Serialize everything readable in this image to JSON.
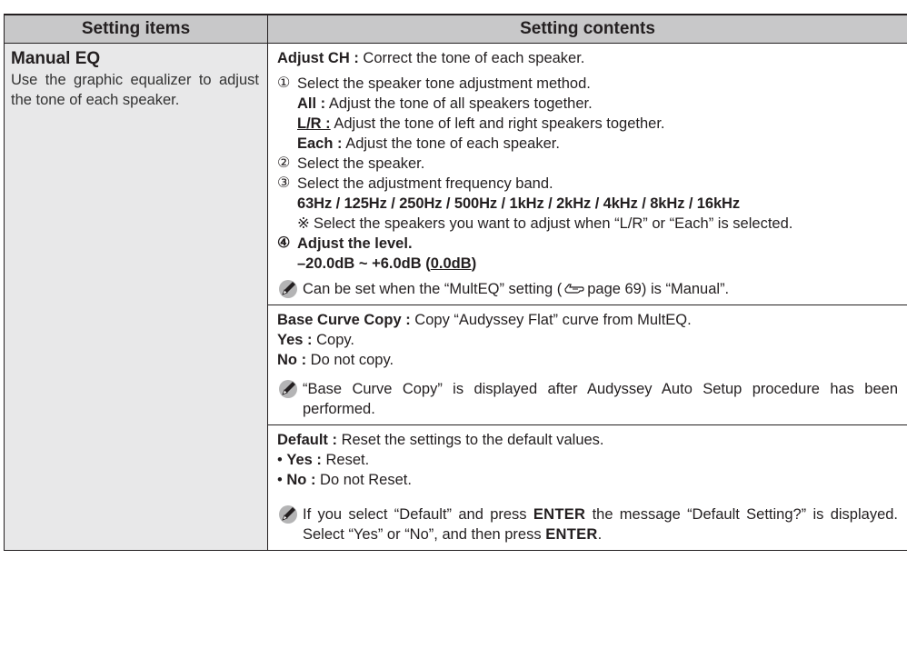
{
  "header": {
    "col_items": "Setting items",
    "col_contents": "Setting contents"
  },
  "item": {
    "title": "Manual EQ",
    "description": "Use the graphic equalizer to adjust the tone of each speaker."
  },
  "adjust_ch": {
    "label": "Adjust CH :",
    "text": " Correct the tone of each speaker.",
    "step1": {
      "num": "①",
      "text": "Select the speaker tone adjustment method.",
      "options": [
        {
          "label": "All :",
          "text": " Adjust the tone of all speakers together."
        },
        {
          "label": "L/R :",
          "text": " Adjust the tone of left and right speakers together."
        },
        {
          "label": "Each :",
          "text": " Adjust the tone of each speaker."
        }
      ]
    },
    "step2": {
      "num": "②",
      "text": "Select the speaker."
    },
    "step3": {
      "num": "③",
      "text": "Select the adjustment frequency band.",
      "bands": "63Hz / 125Hz / 250Hz / 500Hz / 1kHz / 2kHz / 4kHz / 8kHz / 16kHz",
      "note_mark": "※",
      "note": "Select the speakers you want to adjust when “L/R” or “Each” is selected."
    },
    "step4": {
      "num": "④",
      "text": "Adjust the level.",
      "range": "–20.0dB ~ +6.0dB (",
      "default": "0.0dB",
      "range_close": ")"
    },
    "note": {
      "before": "Can be set when the “MultEQ” setting (",
      "page": "page 69",
      "after": ") is “Manual”."
    }
  },
  "base_curve": {
    "label": "Base Curve Copy :",
    "text": " Copy “Audyssey Flat” curve from MultEQ.",
    "options": [
      {
        "label": "Yes :",
        "text": " Copy."
      },
      {
        "label": "No :",
        "text": " Do not copy."
      }
    ],
    "note": "“Base Curve Copy” is displayed after Audyssey Auto Setup procedure has been performed."
  },
  "default": {
    "label": "Default :",
    "text": " Reset the settings to the default values.",
    "bullet": "•",
    "options": [
      {
        "label": "Yes :",
        "text": " Reset."
      },
      {
        "label": "No :",
        "text": " Do not Reset."
      }
    ],
    "note": {
      "part1": "If you select “Default” and press ",
      "enter1": "ENTER",
      "part2": " the message “Default Setting?” is displayed. Select “Yes” or “No”, and then press ",
      "enter2": "ENTER",
      "part3": "."
    }
  }
}
